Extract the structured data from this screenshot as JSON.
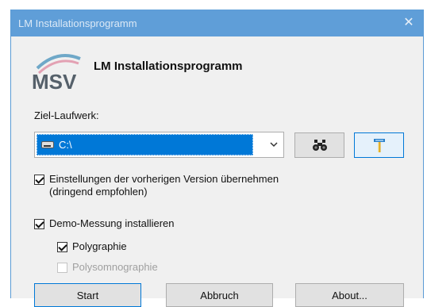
{
  "window": {
    "title": "LM Installationsprogramm",
    "close_glyph": "✕"
  },
  "header": {
    "logo_text": "MSV",
    "app_title": "LM Installationsprogramm"
  },
  "drive": {
    "label": "Ziel-Laufwerk:",
    "selected": "C:\\",
    "icon": "drive-icon"
  },
  "tools": {
    "search_icon": "binoculars-icon",
    "settings_icon": "hammer-icon"
  },
  "options": {
    "keep_settings": {
      "label_line1": "Einstellungen der vorherigen Version übernehmen",
      "label_line2": "(dringend empfohlen)",
      "checked": true
    },
    "demo_measurement": {
      "label": "Demo-Messung installieren",
      "checked": true
    },
    "polygraphy": {
      "label": "Polygraphie",
      "checked": true
    },
    "polysomnography": {
      "label": "Polysomnographie",
      "checked": false,
      "disabled": true
    }
  },
  "buttons": {
    "start": "Start",
    "cancel": "Abbruch",
    "about": "About..."
  },
  "colors": {
    "titlebar": "#5f9ed8",
    "selection": "#0078d7",
    "dialog_bg": "#f0f0f0"
  }
}
